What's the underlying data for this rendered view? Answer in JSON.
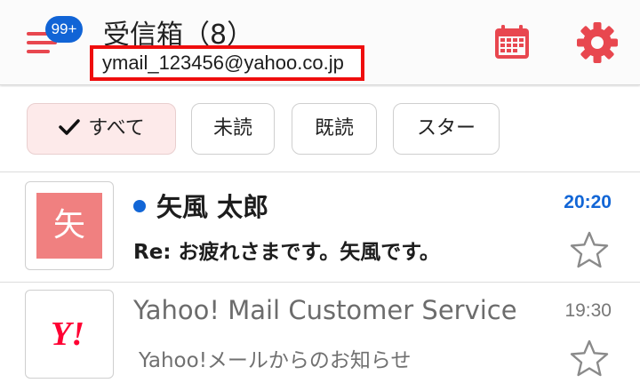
{
  "header": {
    "menu_badge": "99+",
    "title": "受信箱（8）",
    "account_email": "ymail_123456@yahoo.co.jp"
  },
  "filters": [
    {
      "label": "すべて",
      "active": true
    },
    {
      "label": "未読",
      "active": false
    },
    {
      "label": "既読",
      "active": false
    },
    {
      "label": "スター",
      "active": false
    }
  ],
  "messages": [
    {
      "avatar_text": "矢",
      "sender": "矢風 太郎",
      "subject": "Re: お疲れさまです。矢風です。",
      "time": "20:20",
      "unread": true,
      "starred": false
    },
    {
      "avatar_text": "Y!",
      "sender": "Yahoo! Mail Customer Service",
      "subject": "Yahoo!メールからのお知らせ",
      "time": "19:30",
      "unread": false,
      "starred": false
    }
  ],
  "colors": {
    "accent": "#e8474f",
    "badge": "#1164d6",
    "unread_dot": "#1266d6",
    "highlight_border": "#ef0d0d",
    "yahoo_red": "#ff0033"
  },
  "icons": [
    "menu-icon",
    "calendar-icon",
    "gear-icon",
    "checkmark-icon",
    "star-outline-icon",
    "yahoo-logo"
  ]
}
